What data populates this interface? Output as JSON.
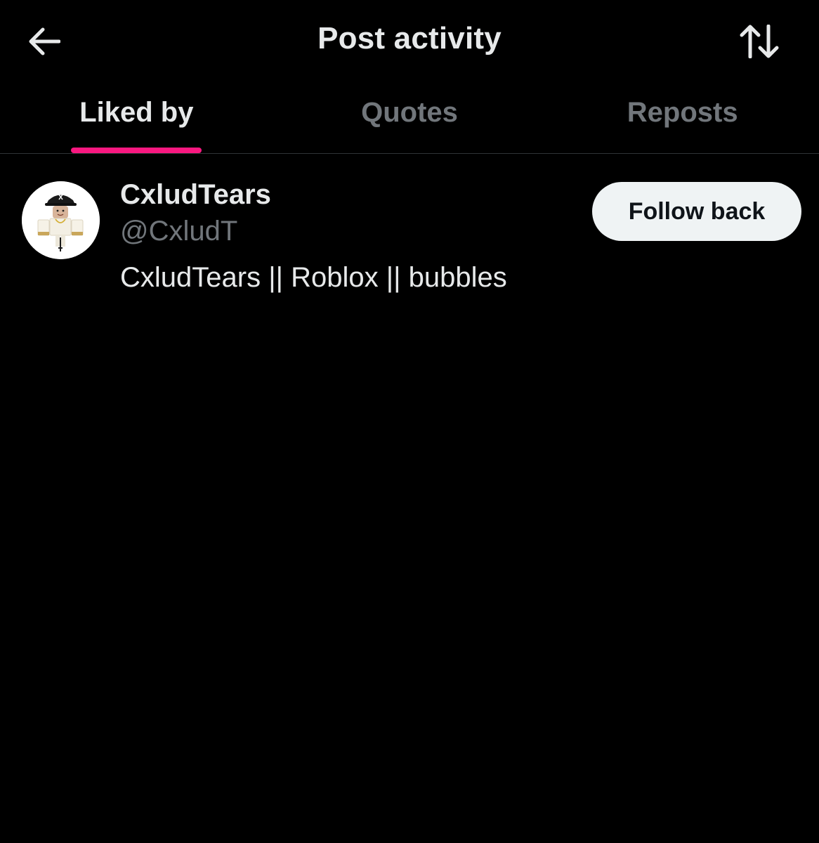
{
  "header": {
    "title": "Post activity",
    "back_icon": "arrow-left-icon",
    "sort_icon": "sort-arrows-icon"
  },
  "tabs": [
    {
      "label": "Liked by",
      "active": true
    },
    {
      "label": "Quotes",
      "active": false
    },
    {
      "label": "Reposts",
      "active": false
    }
  ],
  "users": [
    {
      "display_name": "CxludTears",
      "handle": "@CxludT",
      "bio": "CxludTears || Roblox || bubbles",
      "follow_label": "Follow back",
      "avatar_icon": "roblox-avatar"
    }
  ],
  "colors": {
    "background": "#000000",
    "accent": "#f91880",
    "primary_text": "#e7e9ea",
    "secondary_text": "#71767b",
    "button_bg": "#eff3f4",
    "button_text": "#0f1419",
    "divider": "#2f3336"
  }
}
